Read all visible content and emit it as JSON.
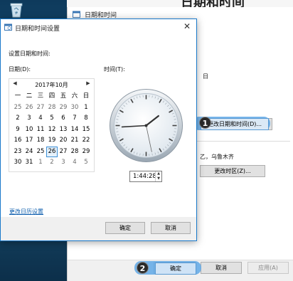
{
  "background_window": {
    "title": "日期和时间",
    "top_right_title": "日期和时间",
    "partial_text_1": "日",
    "change_datetime_button": "更改日期和时间(D)...",
    "timezone_text": "乙，乌鲁木齐",
    "change_timezone_button": "更改时区(Z)...",
    "ok_button": "确定",
    "cancel_button": "取消",
    "apply_button": "应用(A)"
  },
  "dialog": {
    "title": "日期和时间设置",
    "instruction": "设置日期和时间:",
    "date_label": "日期(D):",
    "time_label": "时间(T):",
    "calendar": {
      "month_title": "2017年10月",
      "weekdays": [
        "一",
        "二",
        "三",
        "四",
        "五",
        "六",
        "日"
      ],
      "selected_day": "26",
      "days": [
        {
          "d": "25",
          "other": true
        },
        {
          "d": "26",
          "other": true
        },
        {
          "d": "27",
          "other": true
        },
        {
          "d": "28",
          "other": true
        },
        {
          "d": "29",
          "other": true
        },
        {
          "d": "30",
          "other": true
        },
        {
          "d": "1"
        },
        {
          "d": "2"
        },
        {
          "d": "3"
        },
        {
          "d": "4"
        },
        {
          "d": "5"
        },
        {
          "d": "6"
        },
        {
          "d": "7"
        },
        {
          "d": "8"
        },
        {
          "d": "9"
        },
        {
          "d": "10"
        },
        {
          "d": "11"
        },
        {
          "d": "12"
        },
        {
          "d": "13"
        },
        {
          "d": "14"
        },
        {
          "d": "15"
        },
        {
          "d": "16"
        },
        {
          "d": "17"
        },
        {
          "d": "18"
        },
        {
          "d": "19"
        },
        {
          "d": "20"
        },
        {
          "d": "21"
        },
        {
          "d": "22"
        },
        {
          "d": "23"
        },
        {
          "d": "24"
        },
        {
          "d": "25"
        },
        {
          "d": "26",
          "selected": true
        },
        {
          "d": "27"
        },
        {
          "d": "28"
        },
        {
          "d": "29"
        },
        {
          "d": "30"
        },
        {
          "d": "31"
        },
        {
          "d": "1",
          "other": true
        },
        {
          "d": "2",
          "other": true
        },
        {
          "d": "3",
          "other": true
        },
        {
          "d": "4",
          "other": true
        },
        {
          "d": "5",
          "other": true
        }
      ]
    },
    "time_value": "1:44:28",
    "clock_time": {
      "h": 1,
      "m": 44,
      "s": 28
    },
    "change_calendar_link": "更改日历设置",
    "ok_button": "确定",
    "cancel_button": "取消"
  },
  "steps": {
    "step1": "1",
    "step2": "2"
  },
  "colors": {
    "accent": "#1979ca",
    "highlight": "#5fa8e6",
    "link": "#0b5cad"
  }
}
